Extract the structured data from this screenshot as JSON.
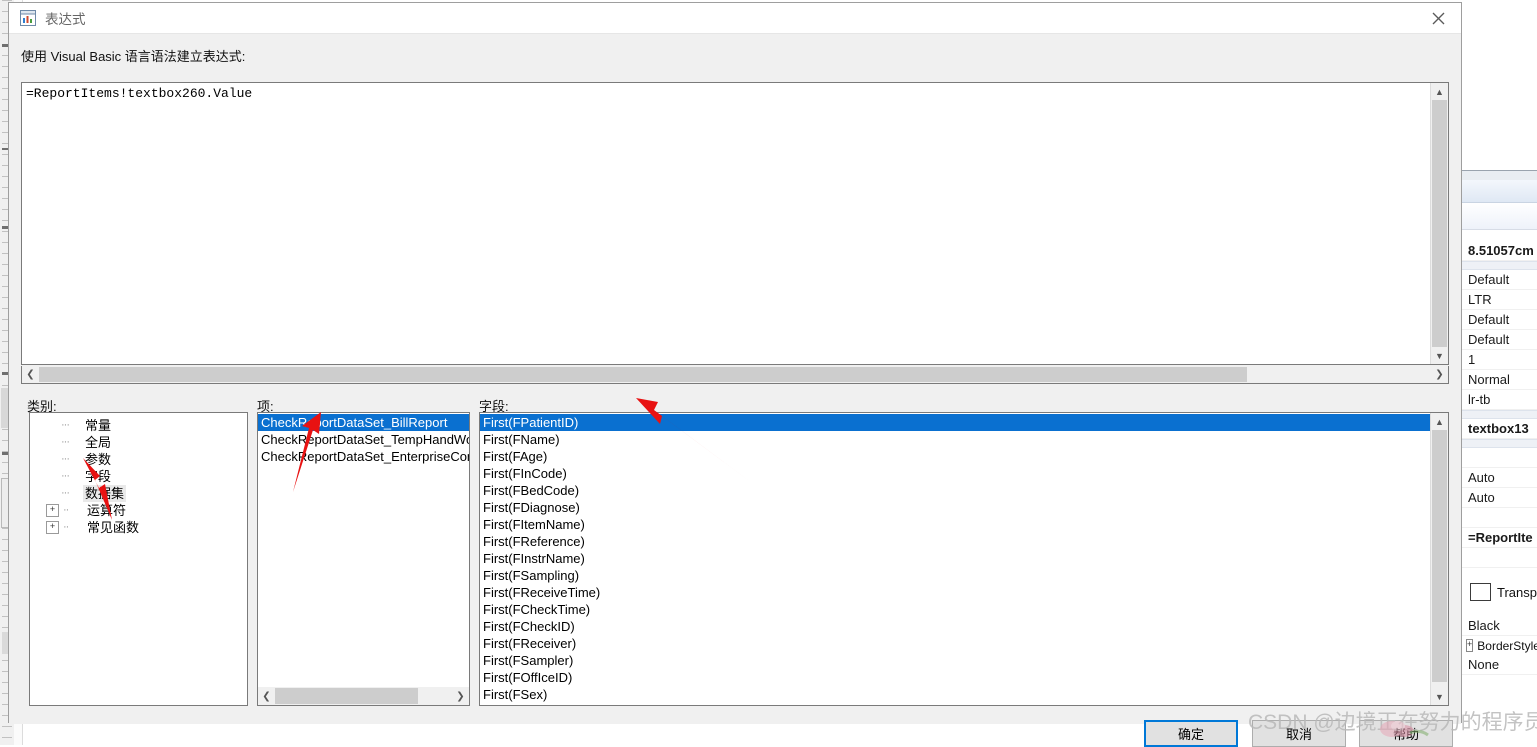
{
  "dialog": {
    "title": "表达式",
    "icon": "expression-icon",
    "close_icon": "close-icon",
    "expression_label": "使用 Visual Basic 语言语法建立表达式:",
    "expression_value": "=ReportItems!textbox260.Value"
  },
  "categories": {
    "label": "类别:",
    "items": [
      {
        "label": "常量",
        "expandable": false,
        "selected": false
      },
      {
        "label": "全局",
        "expandable": false,
        "selected": false
      },
      {
        "label": "参数",
        "expandable": false,
        "selected": false
      },
      {
        "label": "字段",
        "expandable": false,
        "selected": false
      },
      {
        "label": "数据集",
        "expandable": false,
        "selected": true
      },
      {
        "label": "运算符",
        "expandable": true,
        "selected": false
      },
      {
        "label": "常见函数",
        "expandable": true,
        "selected": false
      }
    ],
    "expand_glyph": "+"
  },
  "items": {
    "label": "项:",
    "rows": [
      {
        "label": "CheckReportDataSet_BillReport",
        "selected": true
      },
      {
        "label": "CheckReportDataSet_TempHandWo",
        "selected": false
      },
      {
        "label": "CheckReportDataSet_EnterpriseCom",
        "selected": false
      }
    ]
  },
  "fields": {
    "label": "字段:",
    "rows": [
      {
        "label": "First(FPatientID)",
        "selected": true
      },
      {
        "label": "First(FName)",
        "selected": false
      },
      {
        "label": "First(FAge)",
        "selected": false
      },
      {
        "label": "First(FInCode)",
        "selected": false
      },
      {
        "label": "First(FBedCode)",
        "selected": false
      },
      {
        "label": "First(FDiagnose)",
        "selected": false
      },
      {
        "label": "First(FItemName)",
        "selected": false
      },
      {
        "label": "First(FReference)",
        "selected": false
      },
      {
        "label": "First(FInstrName)",
        "selected": false
      },
      {
        "label": "First(FSampling)",
        "selected": false
      },
      {
        "label": "First(FReceiveTime)",
        "selected": false
      },
      {
        "label": "First(FCheckTime)",
        "selected": false
      },
      {
        "label": "First(FCheckID)",
        "selected": false
      },
      {
        "label": "First(FReceiver)",
        "selected": false
      },
      {
        "label": "First(FSampler)",
        "selected": false
      },
      {
        "label": "First(FOffIceID)",
        "selected": false
      },
      {
        "label": "First(FSex)",
        "selected": false
      }
    ]
  },
  "buttons": {
    "ok": "确定",
    "cancel": "取消",
    "help": "帮助"
  },
  "properties_panel": {
    "values": [
      "8.51057cm",
      "Default",
      "LTR",
      "Default",
      "Default",
      "1",
      "Normal",
      "lr-tb",
      "textbox13",
      "Auto",
      "Auto",
      "=ReportIte"
    ],
    "transparent_label": "Transp",
    "border_style_label": "BorderStyle",
    "black_value": "Black",
    "none_value": "None",
    "expand_glyph": "+"
  },
  "watermark": {
    "text": "CSDN @边境正在努力的程序员"
  },
  "annotations": {
    "arrow_color": "#e81212",
    "arrow_count": 3
  }
}
